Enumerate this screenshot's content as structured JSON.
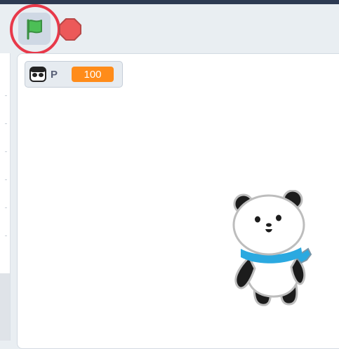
{
  "toolbar": {
    "green_flag_icon": "green-flag-icon",
    "stop_icon": "stop-sign-icon",
    "highlight_color": "#e8394a"
  },
  "stage": {
    "variable_monitor": {
      "label": "P",
      "value": "100",
      "value_color": "#ff8c1a"
    },
    "sprite": {
      "name_icon": "panda-sprite"
    }
  },
  "colors": {
    "flag_green": "#4cbf56",
    "stop_red": "#ec5959",
    "top_bar": "#2d3a52"
  }
}
